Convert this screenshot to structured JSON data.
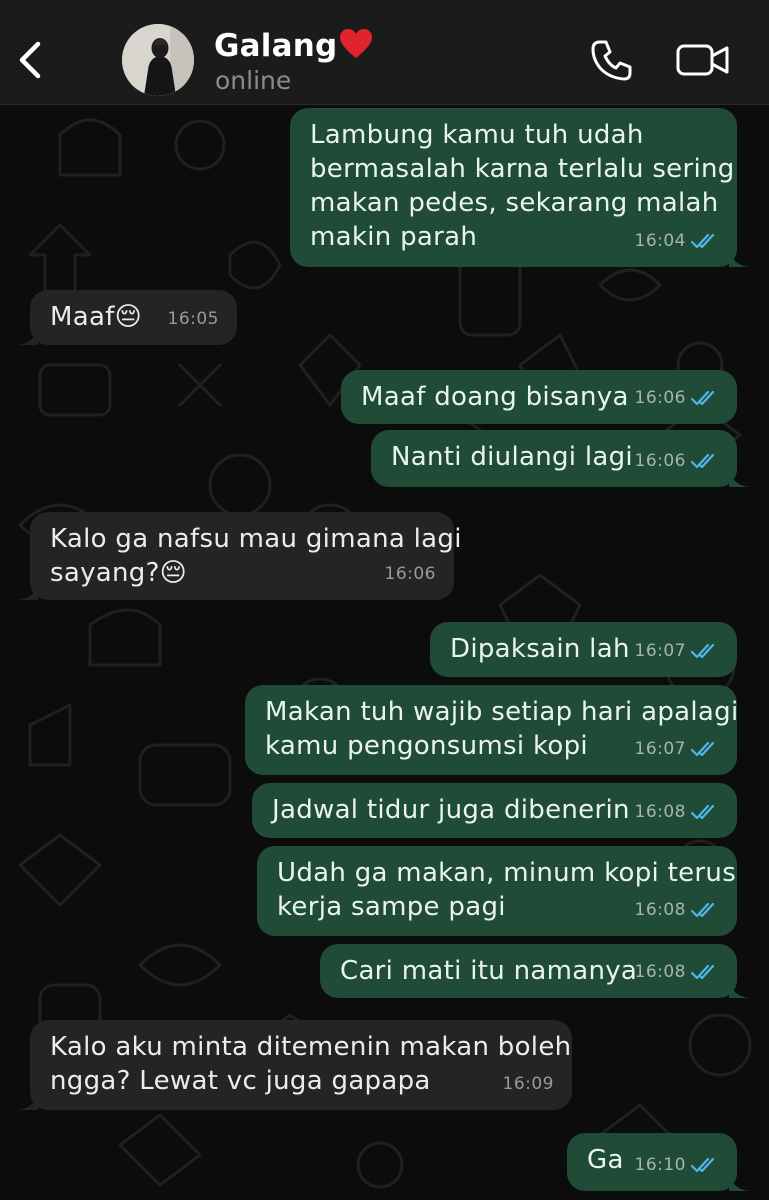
{
  "header": {
    "contact_name": "Galang",
    "status": "online",
    "heart_emoji": "❤️"
  },
  "messages": [
    {
      "dir": "out",
      "text": "Lambung kamu tuh udah\nbermasalah karna terlalu sering\nmakan pedes, sekarang malah\nmakin parah",
      "time": "16:04",
      "read": true
    },
    {
      "dir": "in",
      "text": "Maaf😔",
      "time": "16:05"
    },
    {
      "dir": "out",
      "text": "Maaf doang bisanya",
      "time": "16:06",
      "read": true
    },
    {
      "dir": "out",
      "text": "Nanti diulangi lagi",
      "time": "16:06",
      "read": true
    },
    {
      "dir": "in",
      "text": "Kalo ga nafsu mau gimana lagi\nsayang?😔",
      "time": "16:06"
    },
    {
      "dir": "out",
      "text": "Dipaksain lah",
      "time": "16:07",
      "read": true
    },
    {
      "dir": "out",
      "text": "Makan tuh wajib setiap hari apalagi\nkamu pengonsumsi kopi",
      "time": "16:07",
      "read": true
    },
    {
      "dir": "out",
      "text": "Jadwal tidur juga dibenerin",
      "time": "16:08",
      "read": true
    },
    {
      "dir": "out",
      "text": "Udah ga makan, minum kopi terus\nkerja sampe pagi",
      "time": "16:08",
      "read": true
    },
    {
      "dir": "out",
      "text": "Cari mati itu namanya",
      "time": "16:08",
      "read": true
    },
    {
      "dir": "in",
      "text": "Kalo aku minta ditemenin makan boleh\nngga? Lewat vc juga gapapa",
      "time": "16:09"
    },
    {
      "dir": "out",
      "text": "Ga",
      "time": "16:10",
      "read": true
    }
  ],
  "colors": {
    "outgoing_bubble": "#1f4b37",
    "incoming_bubble": "#242424",
    "read_ticks": "#4fb6ec",
    "header_bg": "#1b1b1b"
  }
}
